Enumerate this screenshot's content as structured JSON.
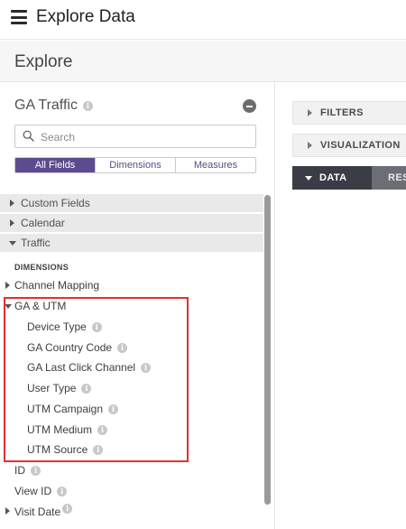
{
  "header": {
    "title": "Explore Data"
  },
  "subheader": {
    "title": "Explore"
  },
  "sidebar": {
    "model_title": "GA Traffic",
    "search": {
      "placeholder": "Search",
      "value": ""
    },
    "tabs": [
      {
        "label": "All Fields",
        "active": true
      },
      {
        "label": "Dimensions",
        "active": false
      },
      {
        "label": "Measures",
        "active": false
      }
    ],
    "views": [
      {
        "label": "Custom Fields",
        "expanded": false
      },
      {
        "label": "Calendar",
        "expanded": false
      },
      {
        "label": "Traffic",
        "expanded": true
      }
    ],
    "section_label": "DIMENSIONS",
    "groups": {
      "channel_mapping": "Channel Mapping",
      "ga_utm": "GA & UTM"
    },
    "ga_utm_fields": [
      "Device Type",
      "GA Country Code",
      "GA Last Click Channel",
      "User Type",
      "UTM Campaign",
      "UTM Medium",
      "UTM Source"
    ],
    "other_fields": {
      "id": "ID",
      "view_id": "View ID",
      "visit_date": "Visit Date"
    }
  },
  "main": {
    "filters_label": "FILTERS",
    "visualization_label": "VISUALIZATION",
    "data_label": "DATA",
    "results_label": "RESULTS"
  },
  "colors": {
    "accent": "#5d4b8f",
    "highlight": "#e2302b",
    "data_tab": "#3a3d45"
  }
}
